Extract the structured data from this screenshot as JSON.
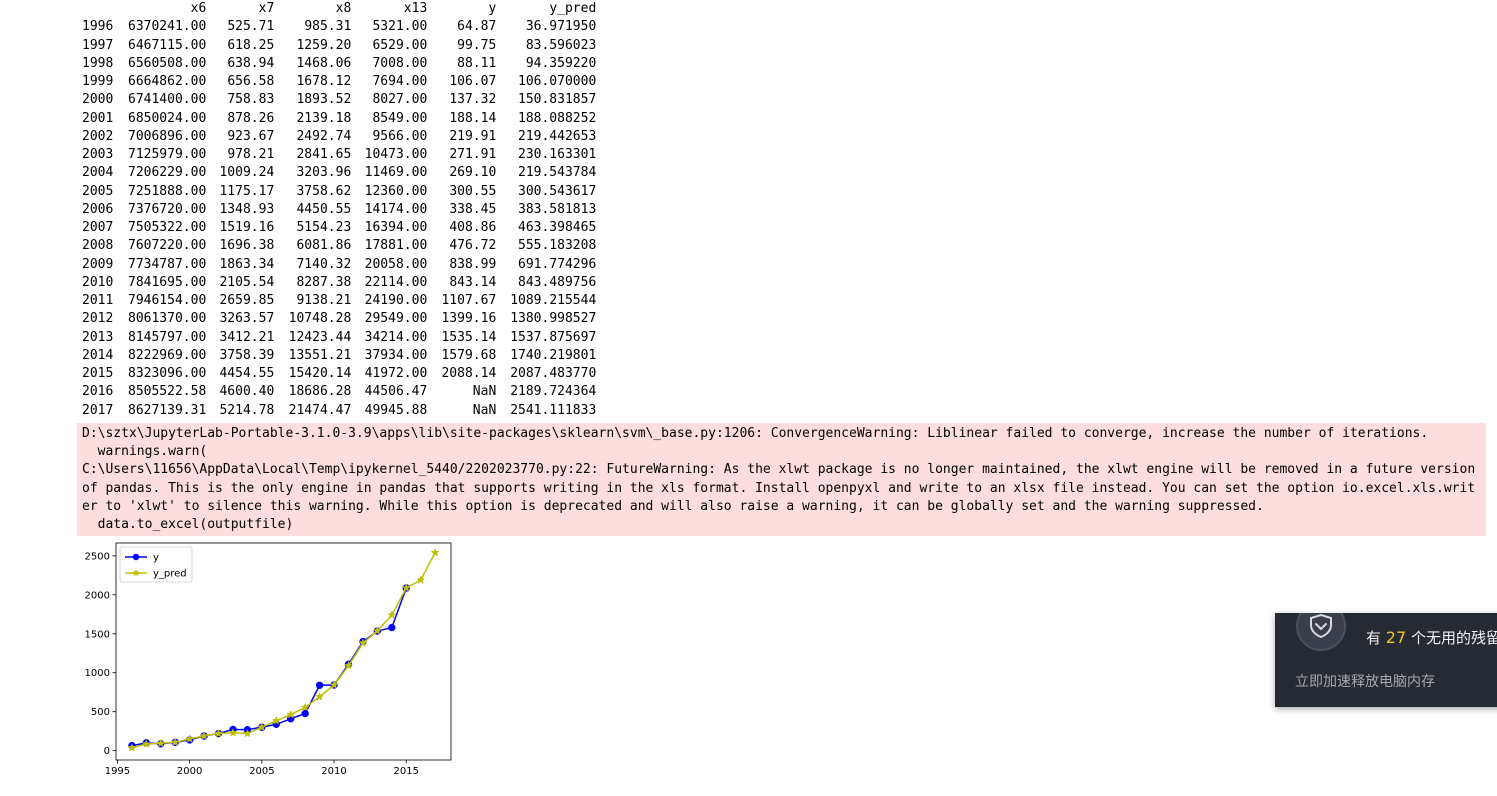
{
  "dataframe": {
    "columns": [
      "",
      "x6",
      "x7",
      "x8",
      "x13",
      "y",
      "y_pred"
    ],
    "rows": [
      [
        "1996",
        "6370241.00",
        "525.71",
        "985.31",
        "5321.00",
        "64.87",
        "36.971950"
      ],
      [
        "1997",
        "6467115.00",
        "618.25",
        "1259.20",
        "6529.00",
        "99.75",
        "83.596023"
      ],
      [
        "1998",
        "6560508.00",
        "638.94",
        "1468.06",
        "7008.00",
        "88.11",
        "94.359220"
      ],
      [
        "1999",
        "6664862.00",
        "656.58",
        "1678.12",
        "7694.00",
        "106.07",
        "106.070000"
      ],
      [
        "2000",
        "6741400.00",
        "758.83",
        "1893.52",
        "8027.00",
        "137.32",
        "150.831857"
      ],
      [
        "2001",
        "6850024.00",
        "878.26",
        "2139.18",
        "8549.00",
        "188.14",
        "188.088252"
      ],
      [
        "2002",
        "7006896.00",
        "923.67",
        "2492.74",
        "9566.00",
        "219.91",
        "219.442653"
      ],
      [
        "2003",
        "7125979.00",
        "978.21",
        "2841.65",
        "10473.00",
        "271.91",
        "230.163301"
      ],
      [
        "2004",
        "7206229.00",
        "1009.24",
        "3203.96",
        "11469.00",
        "269.10",
        "219.543784"
      ],
      [
        "2005",
        "7251888.00",
        "1175.17",
        "3758.62",
        "12360.00",
        "300.55",
        "300.543617"
      ],
      [
        "2006",
        "7376720.00",
        "1348.93",
        "4450.55",
        "14174.00",
        "338.45",
        "383.581813"
      ],
      [
        "2007",
        "7505322.00",
        "1519.16",
        "5154.23",
        "16394.00",
        "408.86",
        "463.398465"
      ],
      [
        "2008",
        "7607220.00",
        "1696.38",
        "6081.86",
        "17881.00",
        "476.72",
        "555.183208"
      ],
      [
        "2009",
        "7734787.00",
        "1863.34",
        "7140.32",
        "20058.00",
        "838.99",
        "691.774296"
      ],
      [
        "2010",
        "7841695.00",
        "2105.54",
        "8287.38",
        "22114.00",
        "843.14",
        "843.489756"
      ],
      [
        "2011",
        "7946154.00",
        "2659.85",
        "9138.21",
        "24190.00",
        "1107.67",
        "1089.215544"
      ],
      [
        "2012",
        "8061370.00",
        "3263.57",
        "10748.28",
        "29549.00",
        "1399.16",
        "1380.998527"
      ],
      [
        "2013",
        "8145797.00",
        "3412.21",
        "12423.44",
        "34214.00",
        "1535.14",
        "1537.875697"
      ],
      [
        "2014",
        "8222969.00",
        "3758.39",
        "13551.21",
        "37934.00",
        "1579.68",
        "1740.219801"
      ],
      [
        "2015",
        "8323096.00",
        "4454.55",
        "15420.14",
        "41972.00",
        "2088.14",
        "2087.483770"
      ],
      [
        "2016",
        "8505522.58",
        "4600.40",
        "18686.28",
        "44506.47",
        "NaN",
        "2189.724364"
      ],
      [
        "2017",
        "8627139.31",
        "5214.78",
        "21474.47",
        "49945.88",
        "NaN",
        "2541.111833"
      ]
    ]
  },
  "stderr": {
    "lines": [
      "D:\\sztx\\JupyterLab-Portable-3.1.0-3.9\\apps\\lib\\site-packages\\sklearn\\svm\\_base.py:1206: ConvergenceWarning: Liblinear failed to converge, increase the number of iterations.",
      "  warnings.warn(",
      "C:\\Users\\11656\\AppData\\Local\\Temp\\ipykernel_5440/2202023770.py:22: FutureWarning: As the xlwt package is no longer maintained, the xlwt engine will be removed in a future version of pandas. This is the only engine in pandas that supports writing in the xls format. Install openpyxl and write to an xlsx file instead. You can set the option io.excel.xls.writer to 'xlwt' to silence this warning. While this option is deprecated and will also raise a warning, it can be globally set and the warning suppressed.",
      "  data.to_excel(outputfile)"
    ]
  },
  "chart_data": {
    "type": "line",
    "title": "",
    "xlabel": "",
    "ylabel": "",
    "xlim": [
      1994.9,
      2018.1
    ],
    "ylim": [
      -120,
      2665
    ],
    "xticks": [
      1995,
      2000,
      2005,
      2010,
      2015
    ],
    "yticks": [
      0,
      500,
      1000,
      1500,
      2000,
      2500
    ],
    "legend_position": "upper-left",
    "grid": false,
    "series": [
      {
        "name": "y",
        "color": "#0000ff",
        "marker": "circle",
        "x": [
          1996,
          1997,
          1998,
          1999,
          2000,
          2001,
          2002,
          2003,
          2004,
          2005,
          2006,
          2007,
          2008,
          2009,
          2010,
          2011,
          2012,
          2013,
          2014,
          2015
        ],
        "values": [
          64.87,
          99.75,
          88.11,
          106.07,
          137.32,
          188.14,
          219.91,
          271.91,
          269.1,
          300.55,
          338.45,
          408.86,
          476.72,
          838.99,
          843.14,
          1107.67,
          1399.16,
          1535.14,
          1579.68,
          2088.14
        ]
      },
      {
        "name": "y_pred",
        "color": "#bfbf00",
        "marker": "star",
        "x": [
          1996,
          1997,
          1998,
          1999,
          2000,
          2001,
          2002,
          2003,
          2004,
          2005,
          2006,
          2007,
          2008,
          2009,
          2010,
          2011,
          2012,
          2013,
          2014,
          2015,
          2016,
          2017
        ],
        "values": [
          36.97195,
          83.596023,
          94.35922,
          106.07,
          150.831857,
          188.088252,
          219.442653,
          230.163301,
          219.543784,
          300.543617,
          383.581813,
          463.398465,
          555.183208,
          691.774296,
          843.489756,
          1089.215544,
          1380.998527,
          1537.875697,
          1740.219801,
          2087.48377,
          2189.724364,
          2541.111833
        ]
      }
    ]
  },
  "notification": {
    "title_prefix": "有",
    "count": "27",
    "title_suffix": "个无用的残留",
    "action": "立即加速释放电脑内存",
    "icon": "shield-icon",
    "accent": "#f3c623"
  }
}
